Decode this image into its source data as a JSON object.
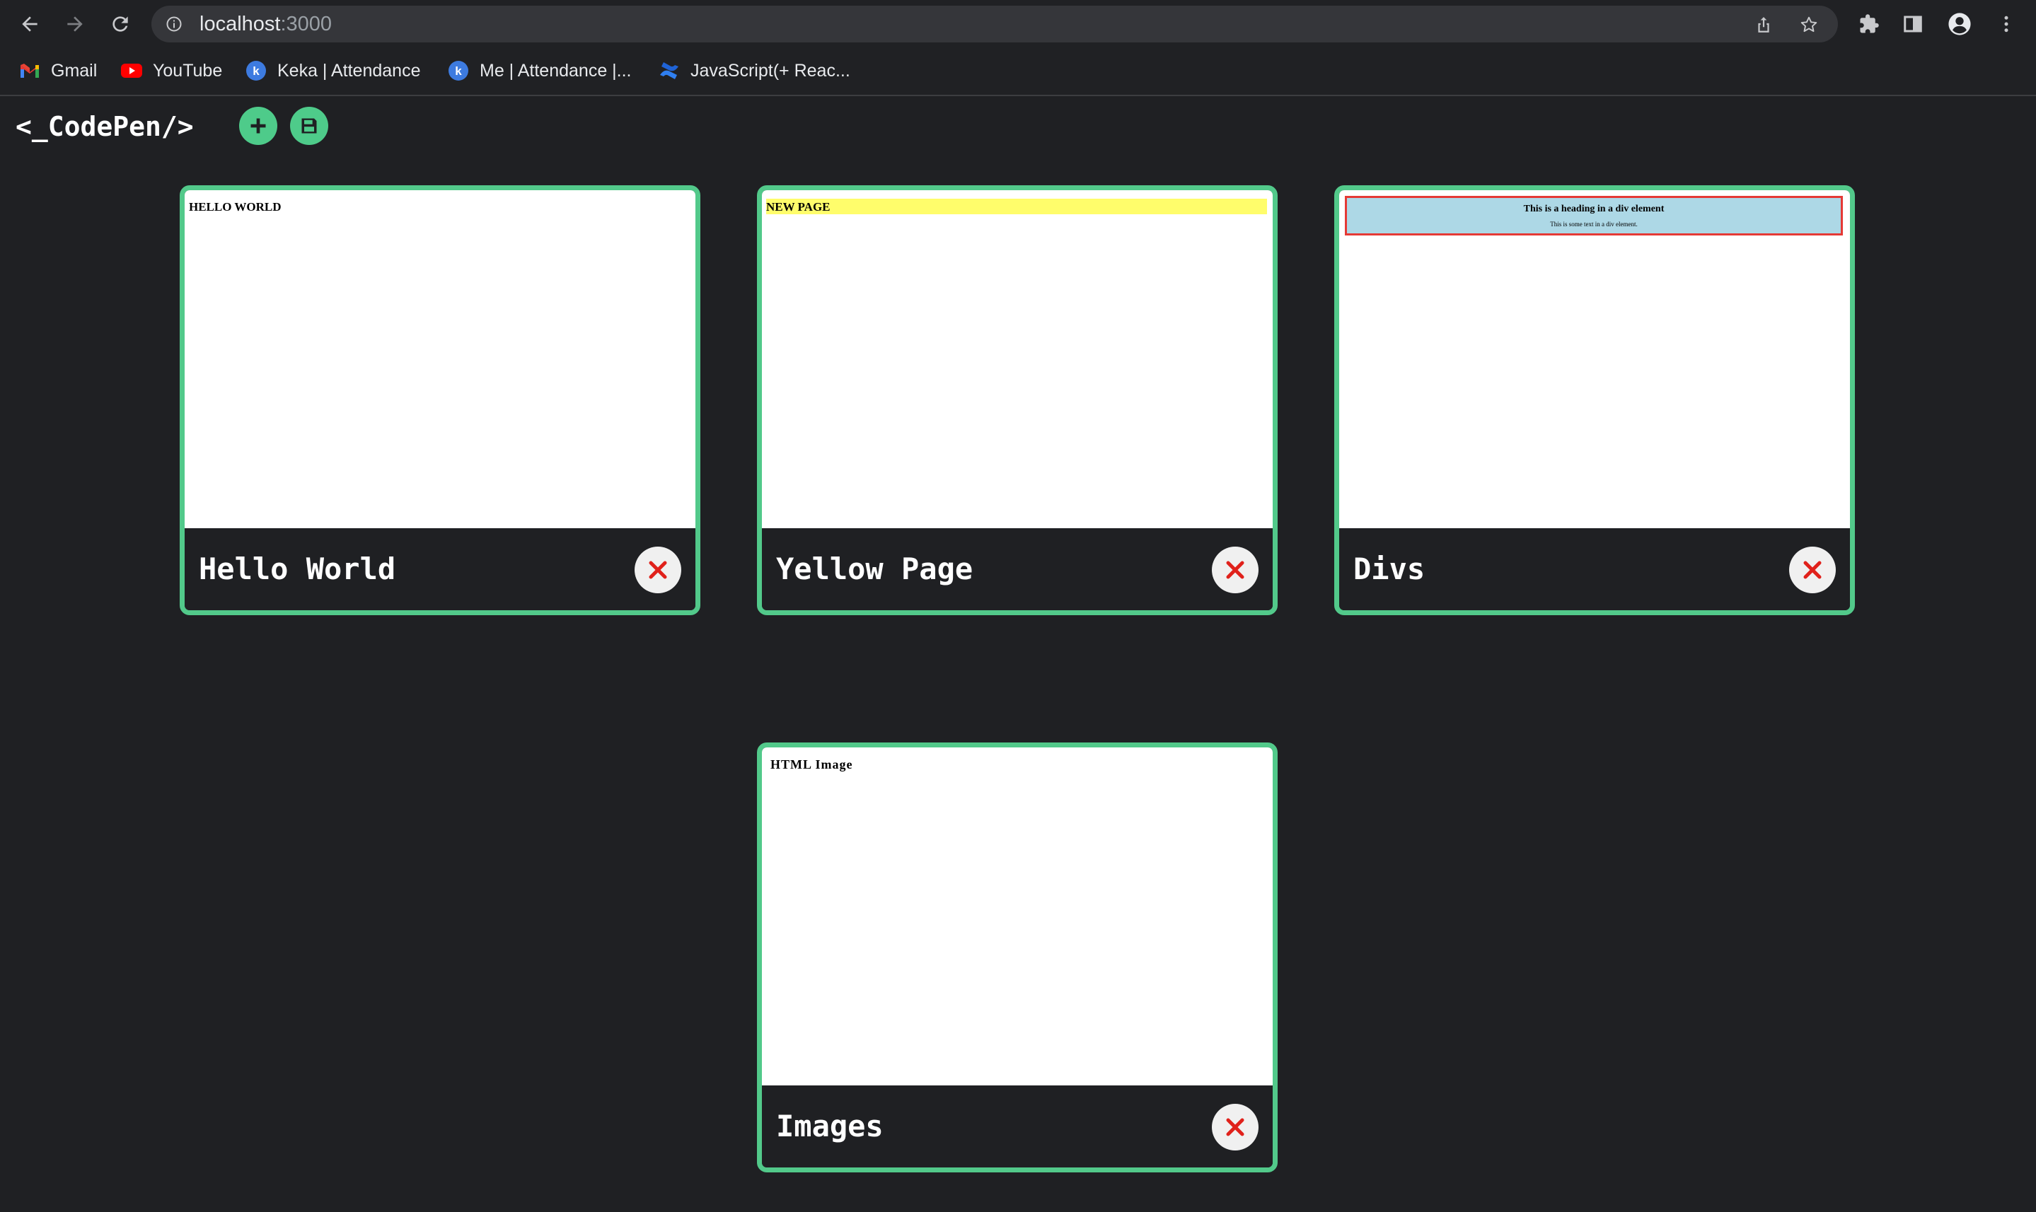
{
  "browser": {
    "url_host": "localhost",
    "url_port": ":3000",
    "bookmarks": [
      {
        "label": "Gmail",
        "icon": "gmail-icon"
      },
      {
        "label": "YouTube",
        "icon": "youtube-icon"
      },
      {
        "label": "Keka | Attendance",
        "icon": "keka-icon"
      },
      {
        "label": "Me | Attendance |...",
        "icon": "keka-icon"
      },
      {
        "label": "JavaScript(+ Reac...",
        "icon": "confluence-icon"
      }
    ]
  },
  "app": {
    "logo": "<_CodePen/>",
    "add_icon": "plus-icon",
    "save_icon": "floppy-disk-icon"
  },
  "cards": [
    {
      "title": "Hello World",
      "preview": {
        "text": "HELLO WORLD"
      }
    },
    {
      "title": "Yellow Page",
      "preview": {
        "text": "NEW PAGE"
      }
    },
    {
      "title": "Divs",
      "preview": {
        "heading": "This is a heading in a div element",
        "text": "This is some text in a div element."
      }
    },
    {
      "title": "Images",
      "preview": {
        "text": "HTML Image"
      }
    }
  ],
  "colors": {
    "accent": "#52c98a",
    "background": "#1f2023",
    "delete": "#e0211b",
    "highlight_yellow": "#fffd6b",
    "div_blue": "#add8e6",
    "div_border_red": "#e53935"
  }
}
